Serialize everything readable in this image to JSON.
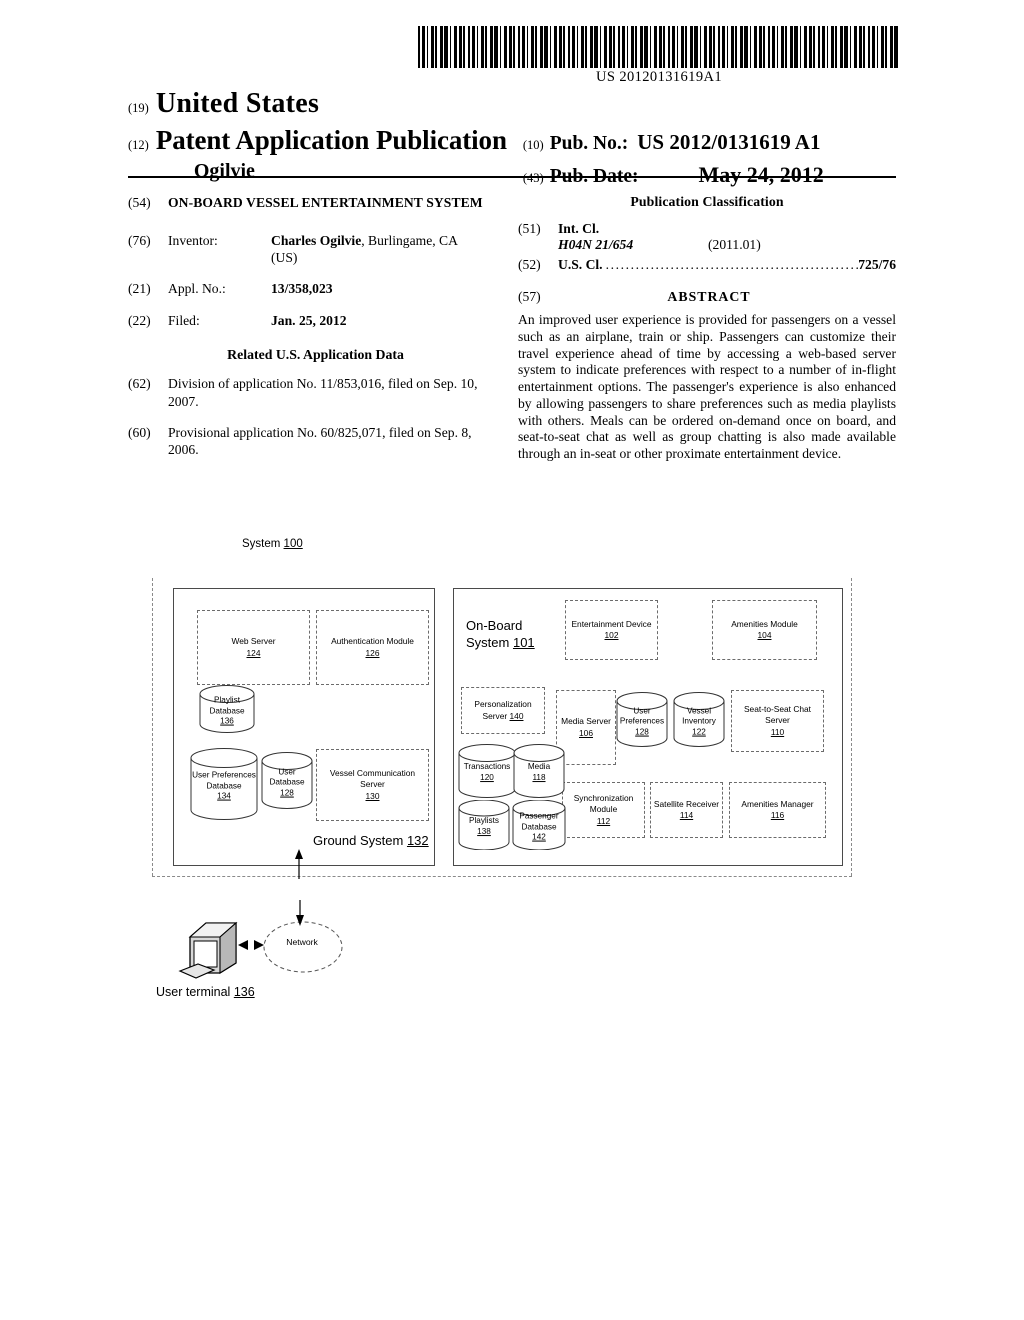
{
  "header": {
    "barcode_number": "US 20120131619A1",
    "code_19": "(19)",
    "country": "United States",
    "code_12": "(12)",
    "publication_type": "Patent Application Publication",
    "inventor_surname": "Ogilvie",
    "code_10": "(10)",
    "pubno_label": "Pub. No.:",
    "pubno_value": "US 2012/0131619 A1",
    "code_43": "(43)",
    "pubdate_label": "Pub. Date:",
    "pubdate_value": "May 24, 2012"
  },
  "left_column": {
    "code_54": "(54)",
    "title": "ON-BOARD VESSEL ENTERTAINMENT SYSTEM",
    "code_76": "(76)",
    "inventor_label": "Inventor:",
    "inventor_name": "Charles Ogilvie",
    "inventor_location": ", Burlingame, CA (US)",
    "code_21": "(21)",
    "applno_label": "Appl. No.:",
    "applno_value": "13/358,023",
    "code_22": "(22)",
    "filed_label": "Filed:",
    "filed_value": "Jan. 25, 2012",
    "related_head": "Related U.S. Application Data",
    "code_62": "(62)",
    "related_62": "Division of application No. 11/853,016, filed on Sep. 10, 2007.",
    "code_60": "(60)",
    "related_60": "Provisional application No. 60/825,071, filed on Sep. 8, 2006."
  },
  "right_column": {
    "pubclass_head": "Publication Classification",
    "code_51": "(51)",
    "intcl_label": "Int. Cl.",
    "ipc_code": "H04N 21/654",
    "ipc_date": "(2011.01)",
    "code_52": "(52)",
    "uscl_label": "U.S. Cl.",
    "uscl_dots": "..........................................................",
    "uscl_value": "725/76",
    "code_57": "(57)",
    "abstract_head": "ABSTRACT",
    "abstract_body": "An improved user experience is provided for passengers on a vessel such as an airplane, train or ship. Passengers can customize their travel experience ahead of time by accessing a web-based server system to indicate preferences with respect to a number of in-flight entertainment options. The passenger's experience is also enhanced by allowing passengers to share preferences such as media playlists with others. Meals can be ordered on-demand once on board, and seat-to-seat chat as well as group chatting is also made available through an in-seat or other proximate entertainment device."
  },
  "figure": {
    "system_label": "System",
    "system_number": "100",
    "ground_system": {
      "label": "Ground System",
      "number": "132",
      "components": [
        {
          "name": "Web Server",
          "number": "124"
        },
        {
          "name": "Authentication Module",
          "number": "126"
        },
        {
          "name": "Vessel Communication Server",
          "number": "130"
        }
      ],
      "databases": [
        {
          "name": "Playlist Database",
          "number": "136"
        },
        {
          "name": "User Preferences Database",
          "number": "134"
        },
        {
          "name": "User Database",
          "number": "128"
        }
      ]
    },
    "onboard_system": {
      "label_line1": "On-Board",
      "label_line2": "System",
      "number": "101",
      "components": [
        {
          "name": "Entertainment Device",
          "number": "102"
        },
        {
          "name": "Amenities Module",
          "number": "104"
        },
        {
          "name": "Personalization Server",
          "number": "140"
        },
        {
          "name": "Media Server",
          "number": "106"
        },
        {
          "name": "Seat-to-Seat Chat Server",
          "number": "110"
        },
        {
          "name": "Synchronization Module",
          "number": "112"
        },
        {
          "name": "Satellite Receiver",
          "number": "114"
        },
        {
          "name": "Amenities Manager",
          "number": "116"
        }
      ],
      "databases": [
        {
          "name": "User Preferences",
          "number": "128"
        },
        {
          "name": "Vessel Inventory",
          "number": "122"
        },
        {
          "name": "Transactions",
          "number": "120"
        },
        {
          "name": "Media",
          "number": "118"
        },
        {
          "name": "Playlists",
          "number": "138"
        },
        {
          "name": "Passenger Database",
          "number": "142"
        }
      ]
    },
    "network": {
      "label": "Network",
      "terminal_label": "User terminal",
      "terminal_number": "136"
    }
  }
}
